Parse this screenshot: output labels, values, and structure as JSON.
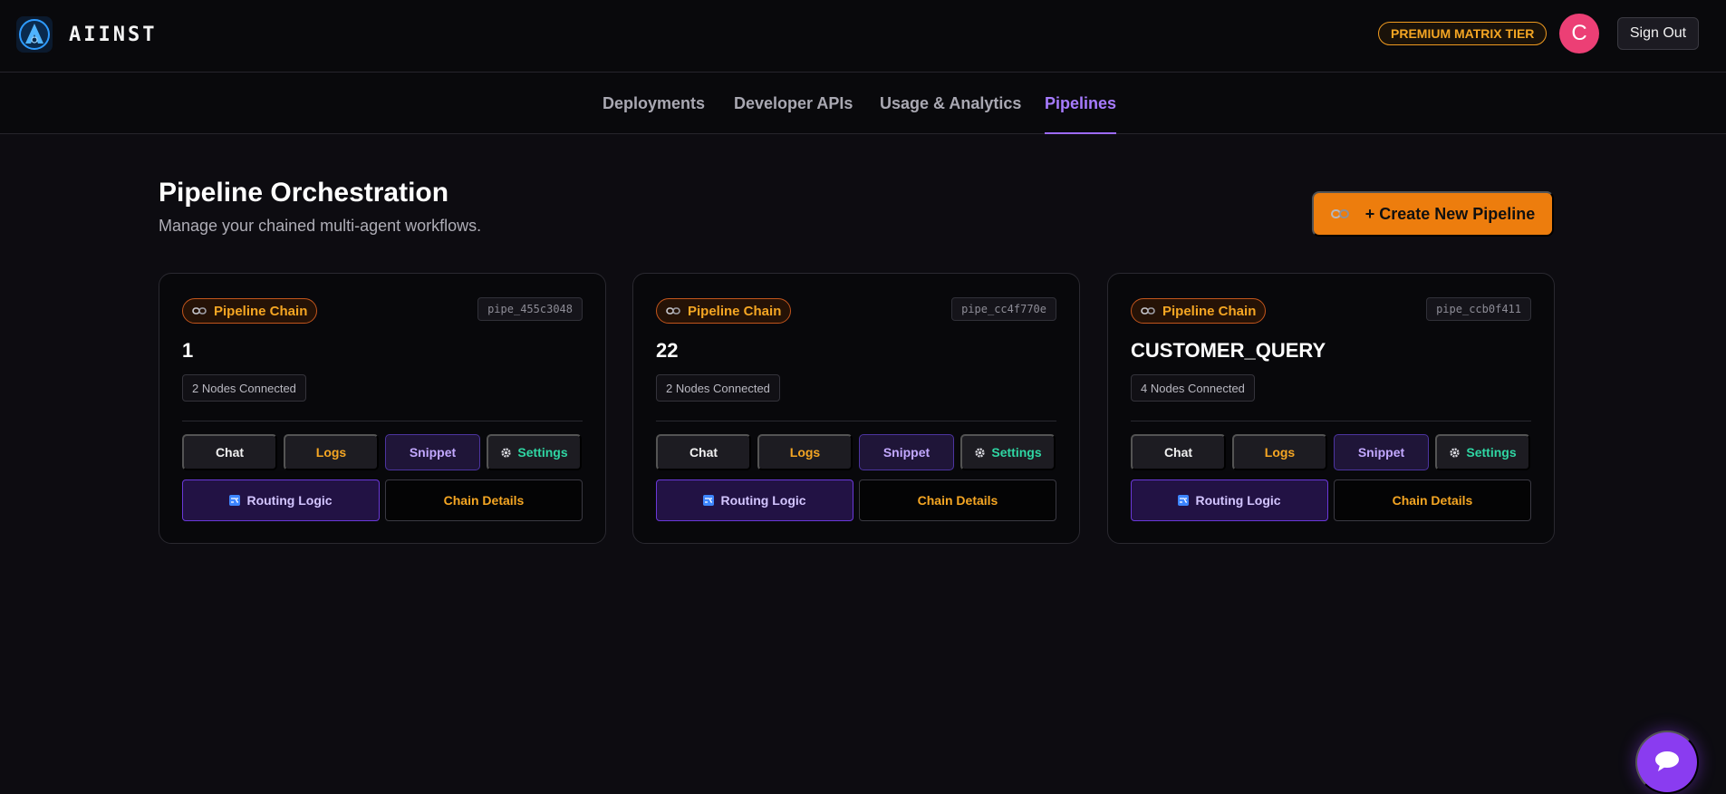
{
  "header": {
    "brand": "AIINST",
    "tier_badge": "PREMIUM MATRIX TIER",
    "avatar_initial": "C",
    "sign_out_label": "Sign Out"
  },
  "nav": {
    "tabs": [
      {
        "label": "Deployments",
        "active": false
      },
      {
        "label": "Developer APIs",
        "active": false
      },
      {
        "label": "Usage & Analytics",
        "active": false
      },
      {
        "label": "Pipelines",
        "active": true
      }
    ]
  },
  "main": {
    "title": "Pipeline Orchestration",
    "subtitle": "Manage your chained multi-agent workflows.",
    "create_label": "+ Create New Pipeline",
    "create_icon": "chain-icon"
  },
  "cards": [
    {
      "chip_label": "Pipeline Chain",
      "pipe_id": "pipe_455c3048",
      "name": "1",
      "nodes": "2 Nodes Connected",
      "actions": {
        "chat": "Chat",
        "logs": "Logs",
        "snippet": "Snippet",
        "settings": "Settings"
      },
      "routing_label": "Routing Logic",
      "details_label": "Chain Details"
    },
    {
      "chip_label": "Pipeline Chain",
      "pipe_id": "pipe_cc4f770e",
      "name": "22",
      "nodes": "2 Nodes Connected",
      "actions": {
        "chat": "Chat",
        "logs": "Logs",
        "snippet": "Snippet",
        "settings": "Settings"
      },
      "routing_label": "Routing Logic",
      "details_label": "Chain Details"
    },
    {
      "chip_label": "Pipeline Chain",
      "pipe_id": "pipe_ccb0f411",
      "name": "CUSTOMER_QUERY",
      "nodes": "4 Nodes Connected",
      "actions": {
        "chat": "Chat",
        "logs": "Logs",
        "snippet": "Snippet",
        "settings": "Settings"
      },
      "routing_label": "Routing Logic",
      "details_label": "Chain Details"
    }
  ],
  "colors": {
    "accent_purple": "#a77bff",
    "accent_orange": "#ed7d0d",
    "accent_teal": "#2fd6a3",
    "background": "#0d0c11"
  },
  "icons": [
    "logo-icon",
    "chain-icon",
    "gear-icon",
    "shuffle-icon",
    "chat-bubble-icon"
  ]
}
